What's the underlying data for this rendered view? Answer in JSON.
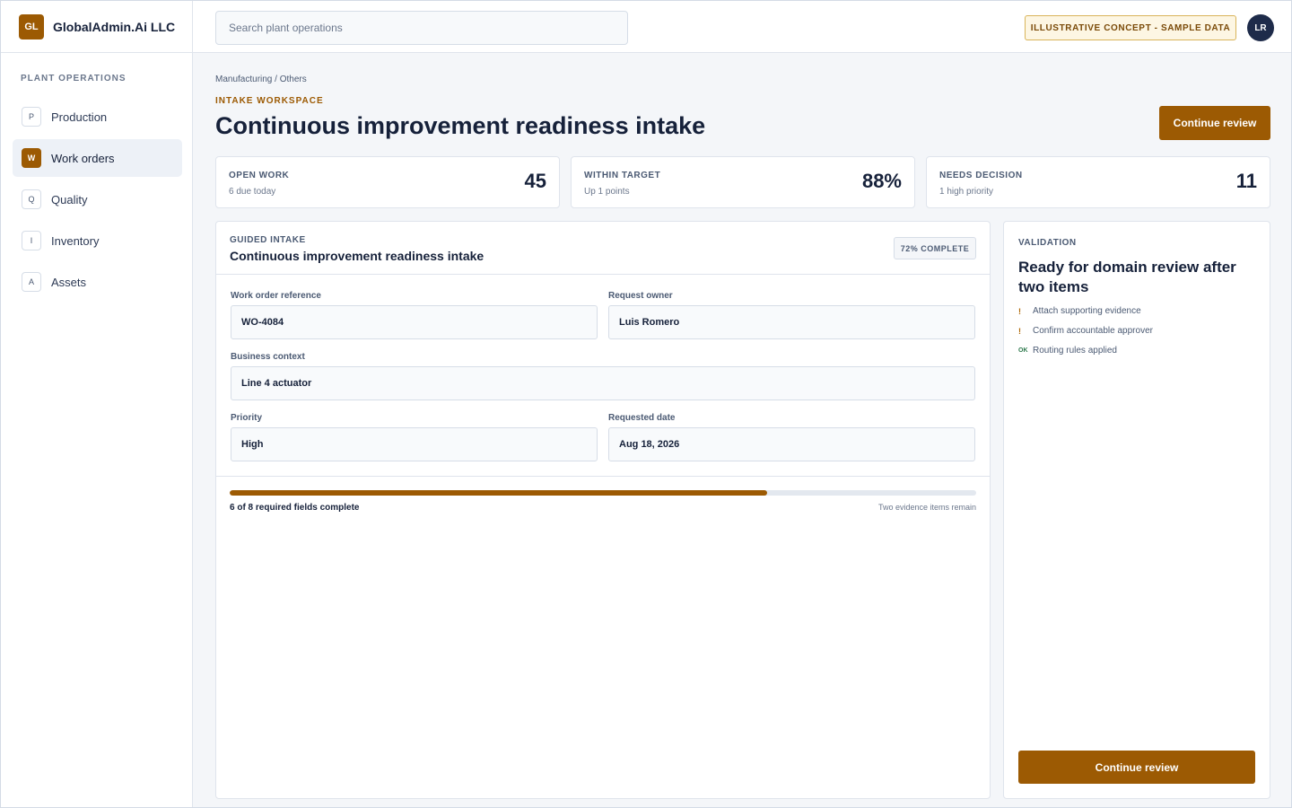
{
  "app": {
    "logo_text": "GL",
    "company": "GlobalAdmin.Ai LLC",
    "search_placeholder": "Search plant operations",
    "concept_badge": "ILLUSTRATIVE CONCEPT - SAMPLE DATA",
    "avatar_initials": "LR",
    "brand_color": "#9c5a03"
  },
  "sidebar": {
    "heading": "PLANT OPERATIONS",
    "items": [
      {
        "key": "P",
        "label": "Production",
        "active": false
      },
      {
        "key": "W",
        "label": "Work orders",
        "active": true
      },
      {
        "key": "Q",
        "label": "Quality",
        "active": false
      },
      {
        "key": "I",
        "label": "Inventory",
        "active": false
      },
      {
        "key": "A",
        "label": "Assets",
        "active": false
      }
    ]
  },
  "header": {
    "breadcrumb": "Manufacturing / Others",
    "eyebrow": "INTAKE WORKSPACE",
    "title": "Continuous improvement readiness intake",
    "primary_action": "Continue review"
  },
  "stats": [
    {
      "label": "OPEN WORK",
      "sub": "6 due today",
      "value": "45"
    },
    {
      "label": "WITHIN TARGET",
      "sub": "Up 1 points",
      "value": "88%"
    },
    {
      "label": "NEEDS DECISION",
      "sub": "1 high priority",
      "value": "11"
    }
  ],
  "intake": {
    "eyebrow": "GUIDED INTAKE",
    "title": "Continuous improvement readiness intake",
    "completion_badge": "72% COMPLETE",
    "fields": {
      "work_order_label": "Work order reference",
      "work_order_value": "WO-4084",
      "owner_label": "Request owner",
      "owner_value": "Luis Romero",
      "context_label": "Business context",
      "context_value": "Line 4 actuator",
      "priority_label": "Priority",
      "priority_value": "High",
      "date_label": "Requested date",
      "date_value": "Aug 18, 2026"
    },
    "progress_fraction": 0.72,
    "progress_text": "6 of 8 required fields complete",
    "progress_note": "Two evidence items remain"
  },
  "validation": {
    "eyebrow": "VALIDATION",
    "title": "Ready for domain review after two items",
    "items": [
      {
        "mark": "!",
        "text": "Attach supporting evidence"
      },
      {
        "mark": "!",
        "text": "Confirm accountable approver"
      },
      {
        "mark": "OK",
        "text": "Routing rules applied"
      }
    ],
    "action": "Continue review"
  }
}
